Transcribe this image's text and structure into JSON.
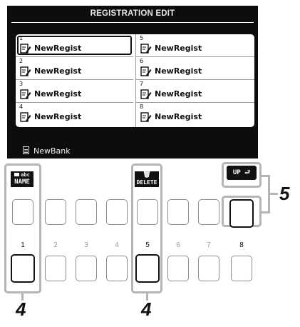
{
  "screen": {
    "title": "REGISTRATION EDIT",
    "bank_name": "NewBank",
    "slots": [
      {
        "num": "1",
        "name": "NewRegist",
        "selected": true
      },
      {
        "num": "2",
        "name": "NewRegist"
      },
      {
        "num": "3",
        "name": "NewRegist"
      },
      {
        "num": "4",
        "name": "NewRegist"
      },
      {
        "num": "5",
        "name": "NewRegist"
      },
      {
        "num": "6",
        "name": "NewRegist"
      },
      {
        "num": "7",
        "name": "NewRegist"
      },
      {
        "num": "8",
        "name": "NewRegist"
      }
    ]
  },
  "buttons": {
    "name_label_top": "abc",
    "name_label": "NAME",
    "delete_label": "DELETE",
    "up_label": "UP",
    "numbers": [
      "1",
      "2",
      "3",
      "4",
      "5",
      "6",
      "7",
      "8"
    ]
  },
  "callouts": {
    "left": "4",
    "middle": "4",
    "right": "5"
  },
  "icons": {
    "slot": "registration-edit-icon",
    "bank": "bank-file-icon",
    "delete": "trash-icon",
    "name": "folder-icon",
    "up": "up-return-arrow-icon"
  }
}
